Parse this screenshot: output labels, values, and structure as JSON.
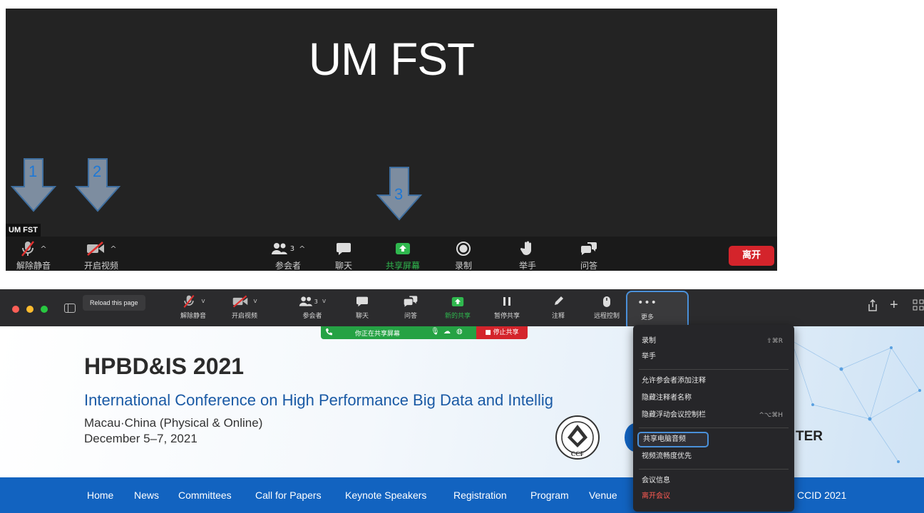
{
  "top": {
    "meeting_name": "UM FST",
    "self_name_label": "UM FST",
    "annotations": [
      "1",
      "2",
      "3"
    ],
    "toolbar": {
      "unmute": "解除静音",
      "start_video": "开启视频",
      "participants": "参会者",
      "participants_count": "3",
      "chat": "聊天",
      "share_screen": "共享屏幕",
      "record": "录制",
      "raise_hand": "举手",
      "qa": "问答",
      "leave": "离开"
    },
    "colors": {
      "share_green": "#2fb84e",
      "leave_red": "#d4242b",
      "annotation_blue": "#1e78d6"
    }
  },
  "bottom": {
    "tooltip": "Reload this page",
    "toolbar": {
      "unmute": "解除静音",
      "start_video": "开启视频",
      "participants": "参会者",
      "participants_count": "3",
      "chat": "聊天",
      "qa": "问答",
      "new_share": "新的共享",
      "pause_share": "暂停共享",
      "annotate": "注释",
      "remote_control": "远程控制",
      "more": "更多"
    },
    "share_bar": {
      "status": "你正在共享屏幕",
      "stop": "停止共享"
    },
    "menu": {
      "record": "录制",
      "record_shortcut": "⇧⌘R",
      "raise_hand": "举手",
      "allow_annotate": "允许参会者添加注释",
      "hide_annotator_names": "隐藏注释者名称",
      "hide_floating_controls": "隐藏浮动会议控制栏",
      "hide_floating_shortcut": "^⌥⌘H",
      "share_computer_audio": "共享电脑音频",
      "optimize_video": "视频流畅度优先",
      "meeting_info": "会议信息",
      "leave_meeting": "离开会议"
    },
    "page": {
      "title": "HPBD&IS 2021",
      "subtitle": "International Conference on High Performance Big Data and Intellig",
      "location": "Macau·China (Physical & Online)",
      "dates": "December 5–7, 2021",
      "partner_partial": "TER",
      "ccf_text": "CCF",
      "nav": [
        "Home",
        "News",
        "Committees",
        "Call for Papers",
        "Keynote Speakers",
        "Registration",
        "Program",
        "Venue",
        "CCID 2021"
      ]
    }
  }
}
